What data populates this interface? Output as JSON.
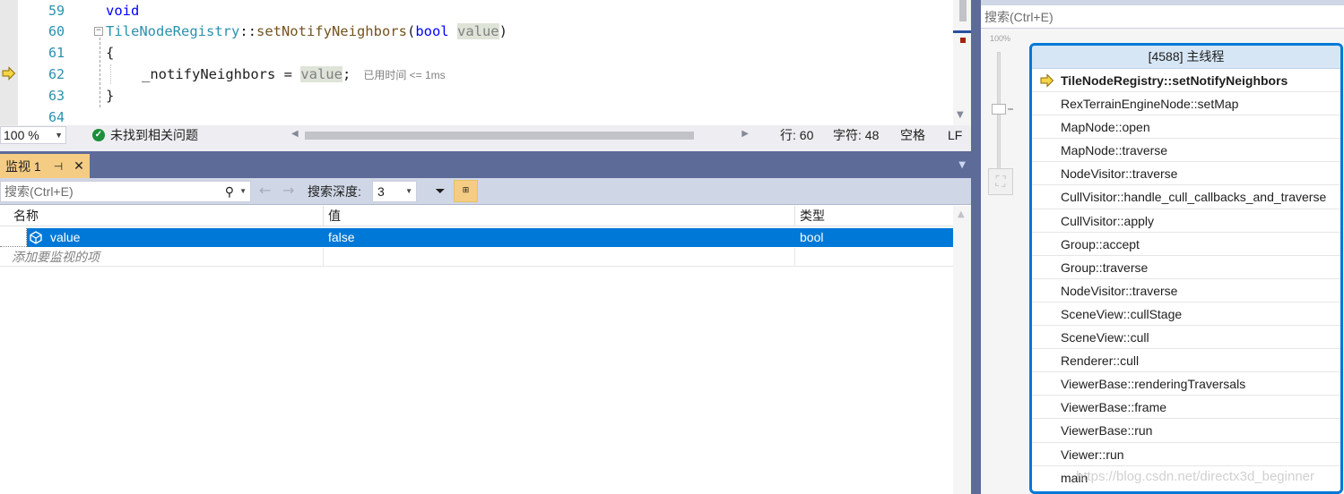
{
  "editor": {
    "line_numbers": [
      "59",
      "60",
      "61",
      "62",
      "63",
      "64"
    ],
    "line59": {
      "keyword": "void"
    },
    "line60": {
      "class": "TileNodeRegistry",
      "sep": "::",
      "method": "setNotifyNeighbors",
      "open": "(",
      "ptype": "bool",
      "pname": "value",
      "close": ")"
    },
    "line61": {
      "text": "{"
    },
    "line62": {
      "member": "_notifyNeighbors",
      "assign": " = ",
      "rhs": "value",
      "semi": ";",
      "perf_tip": "已用时间 <= 1ms"
    },
    "line63": {
      "text": "}"
    }
  },
  "editor_status": {
    "zoom": "100 %",
    "issues": "未找到相关问题",
    "line": "行: 60",
    "char": "字符: 48",
    "spacing": "空格",
    "eol": "LF"
  },
  "watch": {
    "tab_title": "监视 1",
    "search_placeholder": "搜索(Ctrl+E)",
    "depth_label": "搜索深度:",
    "depth_value": "3",
    "columns": {
      "name": "名称",
      "value": "值",
      "type": "类型"
    },
    "rows": [
      {
        "name": "value",
        "value": "false",
        "type": "bool"
      }
    ],
    "add_item_placeholder": "添加要监视的项"
  },
  "parallel_stacks": {
    "search_placeholder": "搜索(Ctrl+E)",
    "zoom_label": "100%",
    "thread_header": "[4588] 主线程",
    "frames": [
      "TileNodeRegistry::setNotifyNeighbors",
      "RexTerrainEngineNode::setMap",
      "MapNode::open",
      "MapNode::traverse",
      "NodeVisitor::traverse",
      "CullVisitor::handle_cull_callbacks_and_traverse",
      "CullVisitor::apply",
      "Group::accept",
      "Group::traverse",
      "NodeVisitor::traverse",
      "SceneView::cullStage",
      "SceneView::cull",
      "Renderer::cull",
      "ViewerBase::renderingTraversals",
      "ViewerBase::frame",
      "ViewerBase::run",
      "Viewer::run",
      "main"
    ]
  },
  "watermark": "https://blog.csdn.net/directx3d_beginner",
  "colors": {
    "accent": "#0078d7",
    "tab_bar": "#5d6b99",
    "active_tab": "#f5cc84",
    "line_number": "#2b91af",
    "keyword": "#0000ff"
  }
}
